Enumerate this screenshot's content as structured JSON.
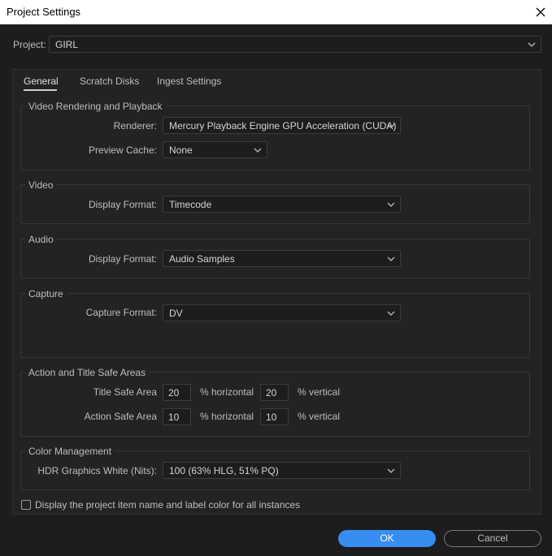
{
  "window": {
    "title": "Project Settings"
  },
  "project": {
    "label": "Project:",
    "value": "GIRL"
  },
  "tabs": [
    {
      "label": "General",
      "active": true
    },
    {
      "label": "Scratch Disks",
      "active": false
    },
    {
      "label": "Ingest Settings",
      "active": false
    }
  ],
  "video_rendering": {
    "title": "Video Rendering and Playback",
    "renderer_label": "Renderer:",
    "renderer_value": "Mercury Playback Engine GPU Acceleration (CUDA)",
    "preview_cache_label": "Preview Cache:",
    "preview_cache_value": "None"
  },
  "video": {
    "title": "Video",
    "display_format_label": "Display Format:",
    "display_format_value": "Timecode"
  },
  "audio": {
    "title": "Audio",
    "display_format_label": "Display Format:",
    "display_format_value": "Audio Samples"
  },
  "capture": {
    "title": "Capture",
    "capture_format_label": "Capture Format:",
    "capture_format_value": "DV"
  },
  "safe_areas": {
    "title": "Action and Title Safe Areas",
    "title_safe_label": "Title Safe Area",
    "title_safe_h": "20",
    "title_safe_v": "20",
    "action_safe_label": "Action Safe Area",
    "action_safe_h": "10",
    "action_safe_v": "10",
    "horizontal_label": "% horizontal",
    "vertical_label": "% vertical"
  },
  "color_management": {
    "title": "Color Management",
    "hdr_label": "HDR Graphics White (Nits):",
    "hdr_value": "100 (63% HLG, 51% PQ)"
  },
  "options": {
    "display_label_color": "Display the project item name and label color for all instances",
    "display_label_color_checked": false
  },
  "buttons": {
    "ok": "OK",
    "cancel": "Cancel"
  },
  "colors": {
    "accent": "#378ef0",
    "background": "#1d1d1d",
    "panel": "#232323"
  }
}
